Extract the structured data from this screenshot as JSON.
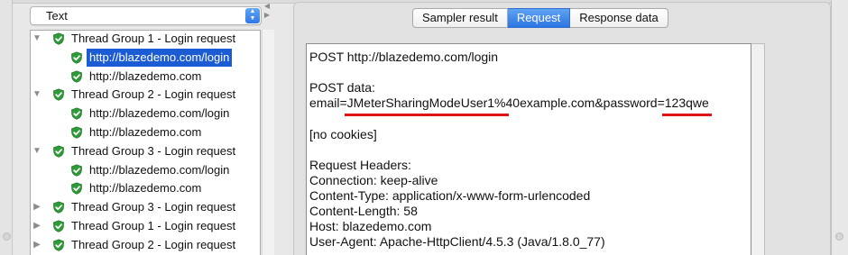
{
  "view_selector": {
    "value": "Text",
    "arrows": "▲▼"
  },
  "splitter": {
    "left": "◀",
    "right": "▶"
  },
  "tree": {
    "rows": [
      {
        "label": "Thread Group 1 - Login request",
        "level": 0,
        "expander": "▼",
        "selected": false
      },
      {
        "label": "http://blazedemo.com/login",
        "level": 1,
        "expander": "",
        "selected": true
      },
      {
        "label": "http://blazedemo.com",
        "level": 1,
        "expander": "",
        "selected": false
      },
      {
        "label": "Thread Group 2 - Login request",
        "level": 0,
        "expander": "▼",
        "selected": false
      },
      {
        "label": "http://blazedemo.com/login",
        "level": 1,
        "expander": "",
        "selected": false
      },
      {
        "label": "http://blazedemo.com",
        "level": 1,
        "expander": "",
        "selected": false
      },
      {
        "label": "Thread Group 3 - Login request",
        "level": 0,
        "expander": "▼",
        "selected": false
      },
      {
        "label": "http://blazedemo.com/login",
        "level": 1,
        "expander": "",
        "selected": false
      },
      {
        "label": "http://blazedemo.com",
        "level": 1,
        "expander": "",
        "selected": false
      },
      {
        "label": "Thread Group 3 - Login request",
        "level": 0,
        "expander": "▶",
        "selected": false
      },
      {
        "label": "Thread Group 1 - Login request",
        "level": 0,
        "expander": "▶",
        "selected": false
      },
      {
        "label": "Thread Group 2 - Login request",
        "level": 0,
        "expander": "▶",
        "selected": false
      }
    ],
    "status_color": "#2e9a38"
  },
  "tabs": [
    {
      "label": "Sampler result",
      "active": false
    },
    {
      "label": "Request",
      "active": true
    },
    {
      "label": "Response data",
      "active": false
    }
  ],
  "request": {
    "request_line": "POST http://blazedemo.com/login",
    "post_data_label": "POST data:",
    "post_body": {
      "p1": "email=",
      "email_value": "JMeterSharingModeUser1%",
      "p2": "40example.com&password=",
      "password_value": "123qwe"
    },
    "cookies": "[no cookies]",
    "headers_label": "Request Headers:",
    "headers": [
      "Connection: keep-alive",
      "Content-Type: application/x-www-form-urlencoded",
      "Content-Length: 58",
      "Host: blazedemo.com",
      "User-Agent: Apache-HttpClient/4.5.3 (Java/1.8.0_77)"
    ],
    "highlight_color": "#e01414"
  }
}
